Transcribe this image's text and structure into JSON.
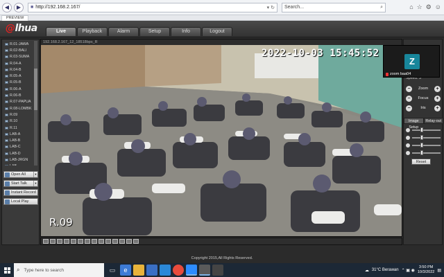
{
  "browser": {
    "url": "http://192.168.2.167/",
    "search_placeholder": "Search...",
    "tab_title": "PREVIEW"
  },
  "app": {
    "logo": "alhua",
    "menu": [
      {
        "label": "Live",
        "active": true
      },
      {
        "label": "Playback",
        "active": false
      },
      {
        "label": "Alarm",
        "active": false
      },
      {
        "label": "Setup",
        "active": false
      },
      {
        "label": "Info",
        "active": false
      },
      {
        "label": "Logout",
        "active": false
      }
    ]
  },
  "channels": [
    "R.01-JAWA",
    "R.02-BALI",
    "R.03-SUMA",
    "R.04-A",
    "R.04-B",
    "R.05-A",
    "R.05-B",
    "R.06-A",
    "R.06-B",
    "R.07-PAPUA",
    "R.08-LOMBK",
    "R.09",
    "R.10",
    "R.11",
    "LAB-A",
    "LAB-B",
    "LAB-C",
    "LAB-D",
    "LAB-JRGN",
    "LAB-..."
  ],
  "controls": {
    "open_all": "Open All",
    "start_talk": "Start Talk",
    "instant_record": "Instant Record",
    "local_play": "Local Play"
  },
  "video": {
    "title": "192.168.2.167_12_18518bps_R",
    "timestamp": "2022-10-03 15:45:52",
    "camera_name": "R.09"
  },
  "ptz": {
    "speed_label": "Speed: 5",
    "zoom": "Zoom",
    "focus": "Focus",
    "iris": "Iris"
  },
  "image_setup": {
    "tab_setup": "Image Setup",
    "tab_relay": "Relay-out",
    "reset": "Reset",
    "sliders": [
      0.35,
      0.35,
      0.35,
      0.35
    ]
  },
  "zoom_overlay": {
    "initial": "Z",
    "name": "zoom baa04"
  },
  "footer": {
    "copyright": "Copyright 2015,All Rights Reserved."
  },
  "taskbar": {
    "search_placeholder": "Type here to search",
    "weather": "31°C  Berawan",
    "time": "3:50 PM",
    "date": "10/3/2022"
  }
}
